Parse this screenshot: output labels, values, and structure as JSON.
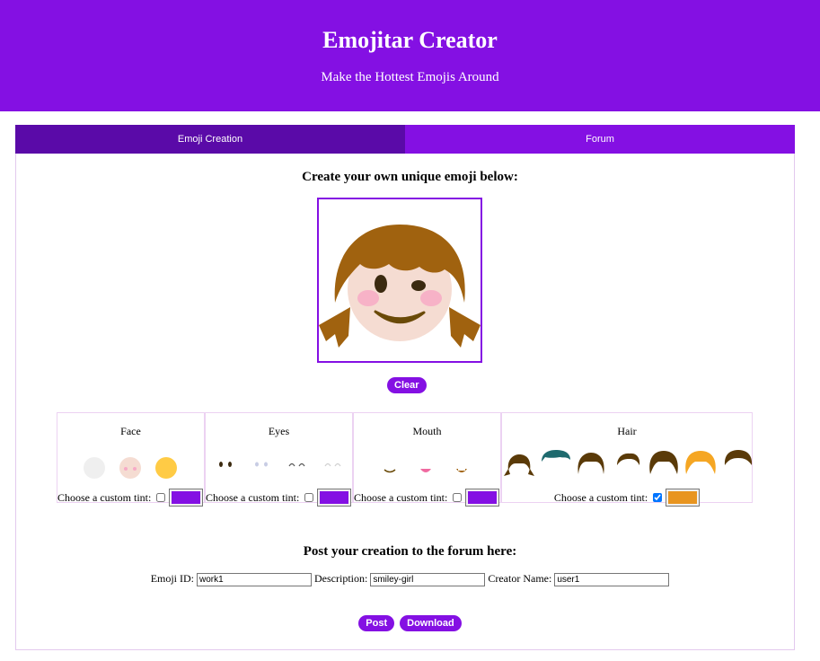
{
  "header": {
    "title": "Emojitar Creator",
    "subtitle": "Make the Hottest Emojis Around"
  },
  "tabs": [
    {
      "label": "Emoji Creation",
      "active": true
    },
    {
      "label": "Forum",
      "active": false
    }
  ],
  "create_title": "Create your own unique emoji below:",
  "clear_label": "Clear",
  "categories": [
    {
      "name": "Face",
      "tint_label": "Choose a custom tint:",
      "tint_checked": false,
      "tint_color": "#8410e3"
    },
    {
      "name": "Eyes",
      "tint_label": "Choose a custom tint:",
      "tint_checked": false,
      "tint_color": "#8410e3"
    },
    {
      "name": "Mouth",
      "tint_label": "Choose a custom tint:",
      "tint_checked": false,
      "tint_color": "#8410e3"
    },
    {
      "name": "Hair",
      "tint_label": "Choose a custom tint:",
      "tint_checked": true,
      "tint_color": "#e89520"
    }
  ],
  "post": {
    "title": "Post your creation to the forum here:",
    "emoji_id_label": "Emoji ID:",
    "emoji_id_value": "work1",
    "description_label": "Description:",
    "description_value": "smiley-girl",
    "creator_label": "Creator Name:",
    "creator_value": "user1",
    "post_label": "Post",
    "download_label": "Download"
  },
  "colors": {
    "accent": "#8410e3",
    "accent_dark": "#5a0aa8",
    "hair_brown": "#a0620f",
    "skin": "#f5dcd2"
  }
}
